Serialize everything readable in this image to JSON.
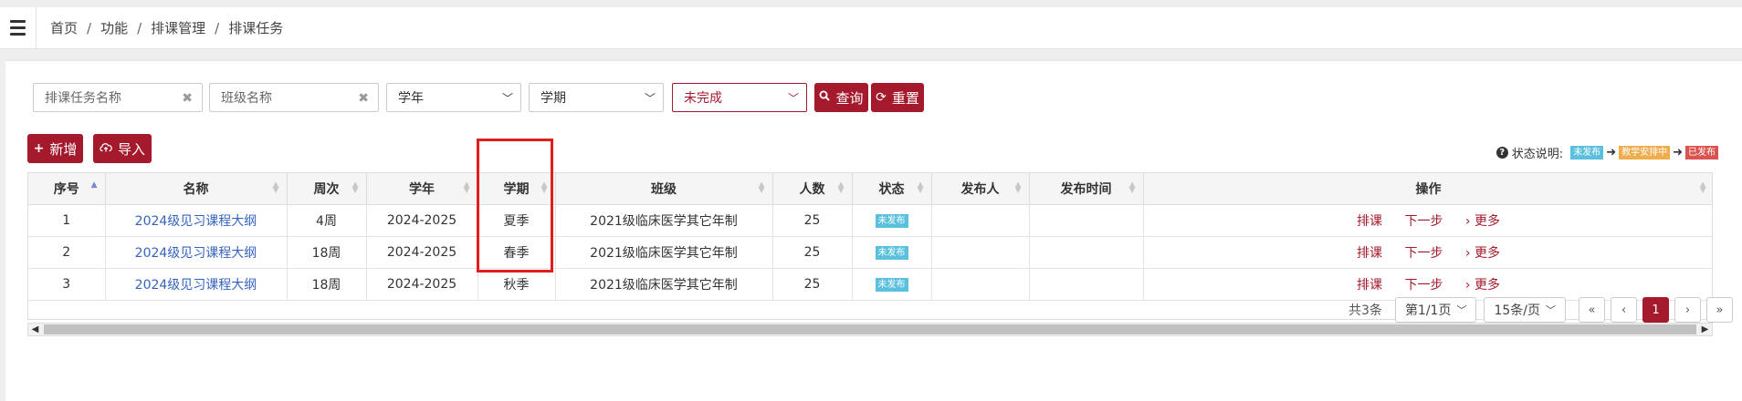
{
  "breadcrumb": [
    "首页",
    "功能",
    "排课管理",
    "排课任务"
  ],
  "breadcrumb_sep": "/",
  "filters": {
    "task_name_placeholder": "排课任务名称",
    "class_name_placeholder": "班级名称",
    "clear_glyph": "✖",
    "school_year": "学年",
    "term": "学期",
    "status": "未完成",
    "search_label": "查询",
    "reset_label": "重置"
  },
  "toolbar": {
    "add_label": "新增",
    "import_label": "导入"
  },
  "legend": {
    "title": "状态说明:",
    "states": [
      "未发布",
      "教学安排中",
      "已发布"
    ],
    "arrow": "➜"
  },
  "table": {
    "columns": [
      "序号",
      "名称",
      "周次",
      "学年",
      "学期",
      "班级",
      "人数",
      "状态",
      "发布人",
      "发布时间",
      "操作"
    ],
    "rows": [
      {
        "no": "1",
        "name": "2024级见习课程大纲",
        "weeks": "4周",
        "year": "2024-2025",
        "term": "夏季",
        "class": "2021级临床医学其它年制",
        "count": "25",
        "status": "未发布",
        "publisher": "",
        "publish_time": "",
        "op_schedule": "排课",
        "op_next": "下一步",
        "op_more": "› 更多"
      },
      {
        "no": "2",
        "name": "2024级见习课程大纲",
        "weeks": "18周",
        "year": "2024-2025",
        "term": "春季",
        "class": "2021级临床医学其它年制",
        "count": "25",
        "status": "未发布",
        "publisher": "",
        "publish_time": "",
        "op_schedule": "排课",
        "op_next": "下一步",
        "op_more": "› 更多"
      },
      {
        "no": "3",
        "name": "2024级见习课程大纲",
        "weeks": "18周",
        "year": "2024-2025",
        "term": "秋季",
        "class": "2021级临床医学其它年制",
        "count": "25",
        "status": "未发布",
        "publisher": "",
        "publish_time": "",
        "op_schedule": "排课",
        "op_next": "下一步",
        "op_more": "› 更多"
      }
    ]
  },
  "pagination": {
    "total": "共3条",
    "page_select": "第1/1页",
    "size_select": "15条/页",
    "first": "«",
    "prev": "‹",
    "current": "1",
    "next": "›",
    "last": "»"
  },
  "colors": {
    "brand": "#a41a2c",
    "link": "#3564c0",
    "status_unpublished": "#5bc0de",
    "status_arranging": "#f0ad4e",
    "status_published": "#d9534f",
    "highlight": "#e01e1e"
  }
}
